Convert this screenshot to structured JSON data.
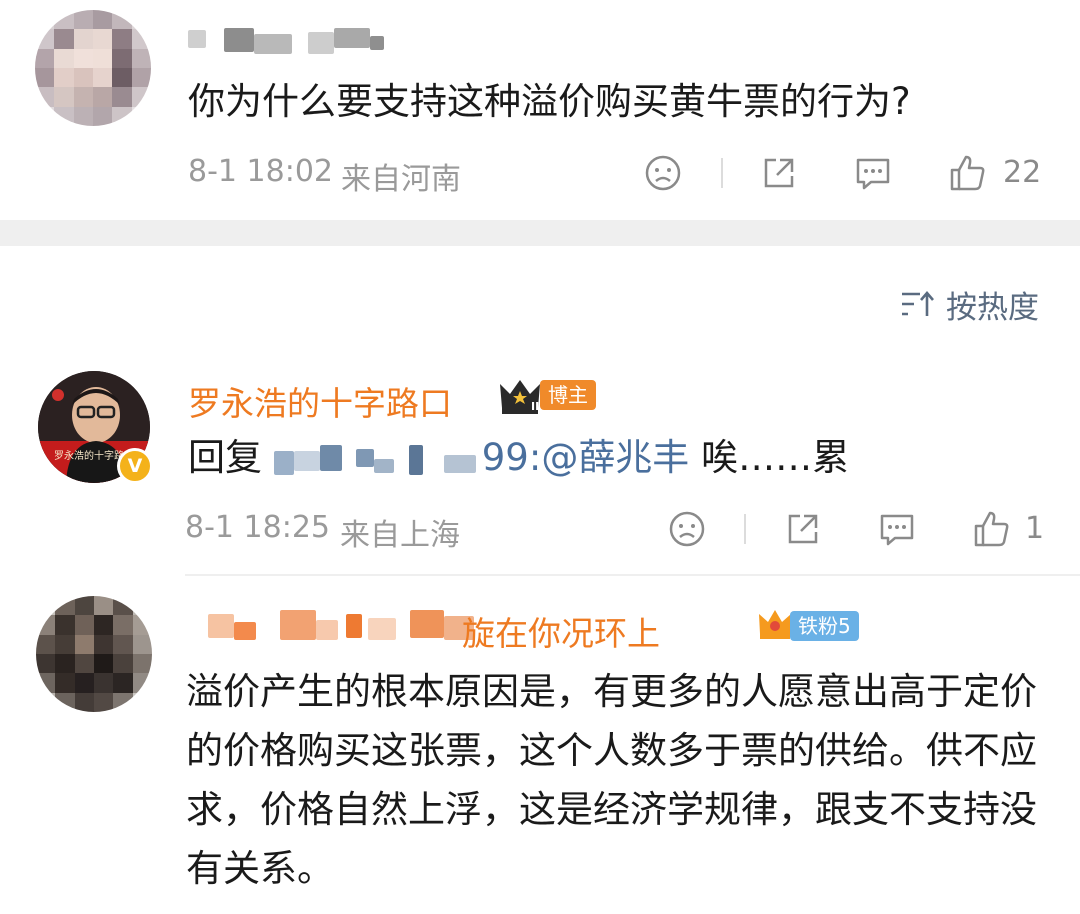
{
  "comment1": {
    "text": "你为什么要支持这种溢价购买黄牛票的行为?",
    "time": "8-1 18:02",
    "location": "来自河南",
    "like_count": "22"
  },
  "sort": {
    "label": "按热度",
    "icon": "sort-icon"
  },
  "comment2": {
    "username": "罗永浩的十字路口",
    "avatar_caption": "罗永浩的十字路口",
    "crown_level": "II",
    "badge": "博主",
    "reply_prefix": "回复",
    "reply_suffix": "99:",
    "mention": "@薛兆丰",
    "reply_text": "唉……累",
    "time": "8-1 18:25",
    "location": "来自上海",
    "like_count": "1",
    "verified_mark": "V"
  },
  "comment3": {
    "username_visible": "旋在你况环上",
    "badge": "铁粉5",
    "text": "溢价产生的根本原因是，有更多的人愿意出高于定价的价格购买这张票，这个人数多于票的供给。供不应求，价格自然上浮，这是经济学规律，跟支不支持没有关系。"
  },
  "colors": {
    "orange": "#ee7a21",
    "link_blue": "#4a6f9d",
    "meta_gray": "#9a9a9a",
    "divider": "#efefef"
  }
}
